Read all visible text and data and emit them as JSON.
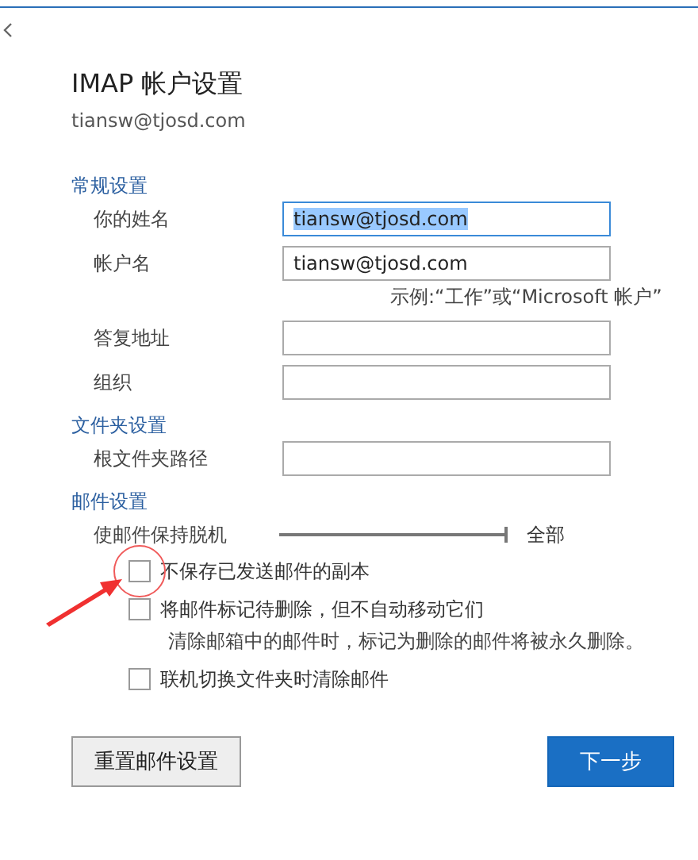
{
  "back": {
    "kind": "chevron"
  },
  "title": "IMAP 帐户设置",
  "subtitle": "tiansw@tjosd.com",
  "sections": [
    {
      "heading": "常规设置",
      "fields": [
        {
          "label": "你的姓名",
          "value": "tiansw@tjosd.com",
          "focused": true
        },
        {
          "label": "帐户名",
          "value": "tiansw@tjosd.com",
          "focused": false,
          "hint": "示例:“工作”或“Microsoft 帐户”"
        },
        {
          "label": "答复地址",
          "focused": false
        },
        {
          "label": "组织",
          "focused": false
        }
      ]
    },
    {
      "heading": "文件夹设置",
      "fields": [
        {
          "label": "根文件夹路径",
          "focused": false
        }
      ]
    },
    {
      "heading": "邮件设置"
    }
  ],
  "offline": {
    "label": "使邮件保持脱机",
    "level": 1,
    "reading": "全部"
  },
  "options": [
    {
      "label": "不保存已发送邮件的副本",
      "checked": false
    },
    {
      "label": "将邮件标记待删除，但不自动移动它们",
      "checked": false,
      "note": "清除邮箱中的邮件时，标记为删除的邮件将被永久删除。"
    },
    {
      "label": "联机切换文件夹时清除邮件",
      "checked": false
    }
  ],
  "buttons": [
    {
      "label": "重置邮件设置",
      "kind": "secondary"
    },
    {
      "label": "下一步",
      "kind": "primary"
    }
  ],
  "annotation": {
    "kind": "circle-arrow"
  }
}
